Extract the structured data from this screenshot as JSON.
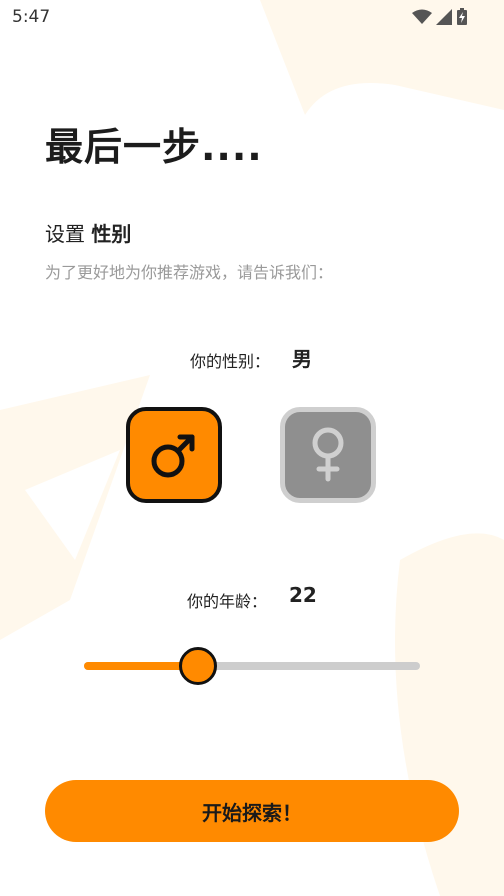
{
  "status_bar": {
    "time": "5:47"
  },
  "title": "最后一步....",
  "subtitle": {
    "prefix": "设置",
    "emphasis": "性别"
  },
  "hint": "为了更好地为你推荐游戏，请告诉我们：",
  "gender": {
    "label": "你的性别：",
    "value": "男",
    "options": [
      "male",
      "female"
    ],
    "selected": "male",
    "colors": {
      "selected_bg": "#FF8A00",
      "unselected_bg": "#8F8F8F"
    }
  },
  "age": {
    "label": "你的年龄：",
    "value": "22",
    "slider_fraction": 0.34
  },
  "cta": {
    "label": "开始探索！"
  },
  "colors": {
    "accent": "#FF8A00",
    "track": "#CDCDCD",
    "deco": "#FFF7EA"
  }
}
